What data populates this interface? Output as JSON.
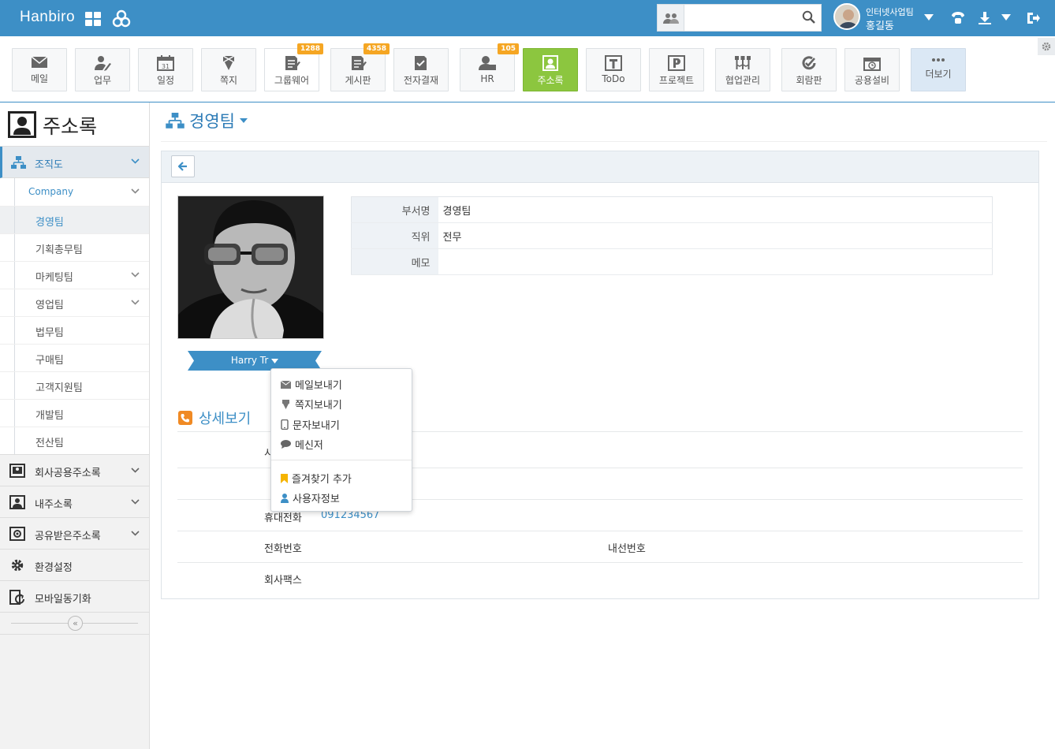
{
  "topbar": {
    "brand": "Hanbiro",
    "search_placeholder": "",
    "user_team": "인터넷사업팀",
    "user_name": "홍길동",
    "accent": "#3d8fc6"
  },
  "toolbar": {
    "items": [
      {
        "label": "메일",
        "icon": "mail-icon"
      },
      {
        "label": "업무",
        "icon": "task-icon"
      },
      {
        "label": "일정",
        "icon": "calendar-icon",
        "calendar_day": "31"
      },
      {
        "label": "쪽지",
        "icon": "memo-icon"
      },
      {
        "label": "그룹웨어",
        "icon": "groupware-icon",
        "badge": "1288"
      },
      {
        "label": "게시판",
        "icon": "board-icon",
        "badge": "4358"
      },
      {
        "label": "전자결재",
        "icon": "approval-icon"
      },
      {
        "label": "HR",
        "icon": "hr-icon",
        "badge": "105"
      },
      {
        "label": "주소록",
        "icon": "addressbook-icon"
      },
      {
        "label": "ToDo",
        "icon": "todo-icon"
      },
      {
        "label": "프로젝트",
        "icon": "project-icon"
      },
      {
        "label": "협업관리",
        "icon": "collab-icon"
      },
      {
        "label": "회람판",
        "icon": "circular-icon"
      },
      {
        "label": "공용설비",
        "icon": "facility-icon"
      },
      {
        "label": "더보기",
        "icon": "more-icon"
      }
    ],
    "active_color": "#8cc63f",
    "badge_color": "#f5a623"
  },
  "sidebar": {
    "title": "주소록",
    "org_label": "조직도",
    "company_label": "Company",
    "teams": [
      "경영팀",
      "기획총무팀",
      "마케팅팀",
      "영업팀",
      "법무팀",
      "구매팀",
      "고객지원팀",
      "개발팀",
      "전산팀"
    ],
    "nav": [
      "회사공용주소록",
      "내주소록",
      "공유받은주소록",
      "환경설정",
      "모바일동기화"
    ],
    "collapse_glyph": "«"
  },
  "main": {
    "page_title": "경영팀",
    "person_name": "Harry Tr",
    "info": [
      {
        "key": "부서명",
        "value": "경영팀"
      },
      {
        "key": "직위",
        "value": "전무"
      },
      {
        "key": "메모",
        "value": ""
      }
    ],
    "detail_title": "상세보기",
    "detail_rows": {
      "hidden_label_fragment": "시",
      "mobile_label": "휴대전화",
      "mobile_value": "091234567",
      "phone_label": "전화번호",
      "ext_label": "내선번호",
      "fax_label": "회사팩스"
    }
  },
  "dropdown": {
    "items": [
      "메일보내기",
      "쪽지보내기",
      "문자보내기",
      "메신저"
    ],
    "items2": [
      "즐겨찾기 추가",
      "사용자정보"
    ]
  }
}
